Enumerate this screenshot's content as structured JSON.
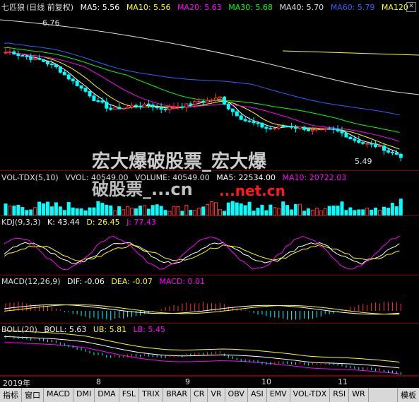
{
  "main": {
    "stock_name": "七匹狼",
    "period": "(日线 前复权)",
    "ma": [
      {
        "label": "MA5: 5.56",
        "color": "#ffffff"
      },
      {
        "label": "MA10: 5.56",
        "color": "#ffff00"
      },
      {
        "label": "MA20: 5.63",
        "color": "#ff00ff"
      },
      {
        "label": "MA30: 5.68",
        "color": "#00ff00"
      },
      {
        "label": "MA40: 5.70",
        "color": "#e0e0e0"
      },
      {
        "label": "MA60: 5.79",
        "color": "#3060ff"
      },
      {
        "label": "MA120",
        "color": "#ffff00"
      }
    ],
    "high_label": "6.76",
    "low_label": "5.49"
  },
  "volume": {
    "title": "VOL-TDX(5,10)",
    "vvol": "VVOL: 40549.00",
    "volume": "VOLUME: 40549.00",
    "ma5": "MA5: 22534.00",
    "ma10": "MA10: 20722.03"
  },
  "kdj": {
    "title": "KDJ(9,3,3)",
    "k": "K: 43.44",
    "d": "D: 26.45",
    "j": "J: 77.43"
  },
  "macd": {
    "title": "MACD(12,26,9)",
    "dif": "DIF: -0.06",
    "dea": "DEA: -0.07",
    "macd": "MACD: 0.01"
  },
  "boll": {
    "title": "BOLL(20)",
    "boll": "BOLL: 5.63",
    "ub": "UB: 5.81",
    "lb": "LB: 5.45"
  },
  "watermark": {
    "line1": "宏大爆破股票_宏大爆",
    "line2": "破股票_...cn",
    "site": "...net.cn"
  },
  "date_axis": [
    "2019年",
    "8",
    "9",
    "10",
    "11"
  ],
  "tabs": [
    "指标",
    "窗口",
    "MACD",
    "DMI",
    "DMA",
    "FSL",
    "TRIX",
    "BRAR",
    "CR",
    "VR",
    "OBV",
    "ASI",
    "EMV",
    "VOL-TDX",
    "RSI",
    "WR",
    "模板"
  ],
  "colors": {
    "up": "#ff3232",
    "down": "#00ffff",
    "grid": "#7a0000"
  }
}
